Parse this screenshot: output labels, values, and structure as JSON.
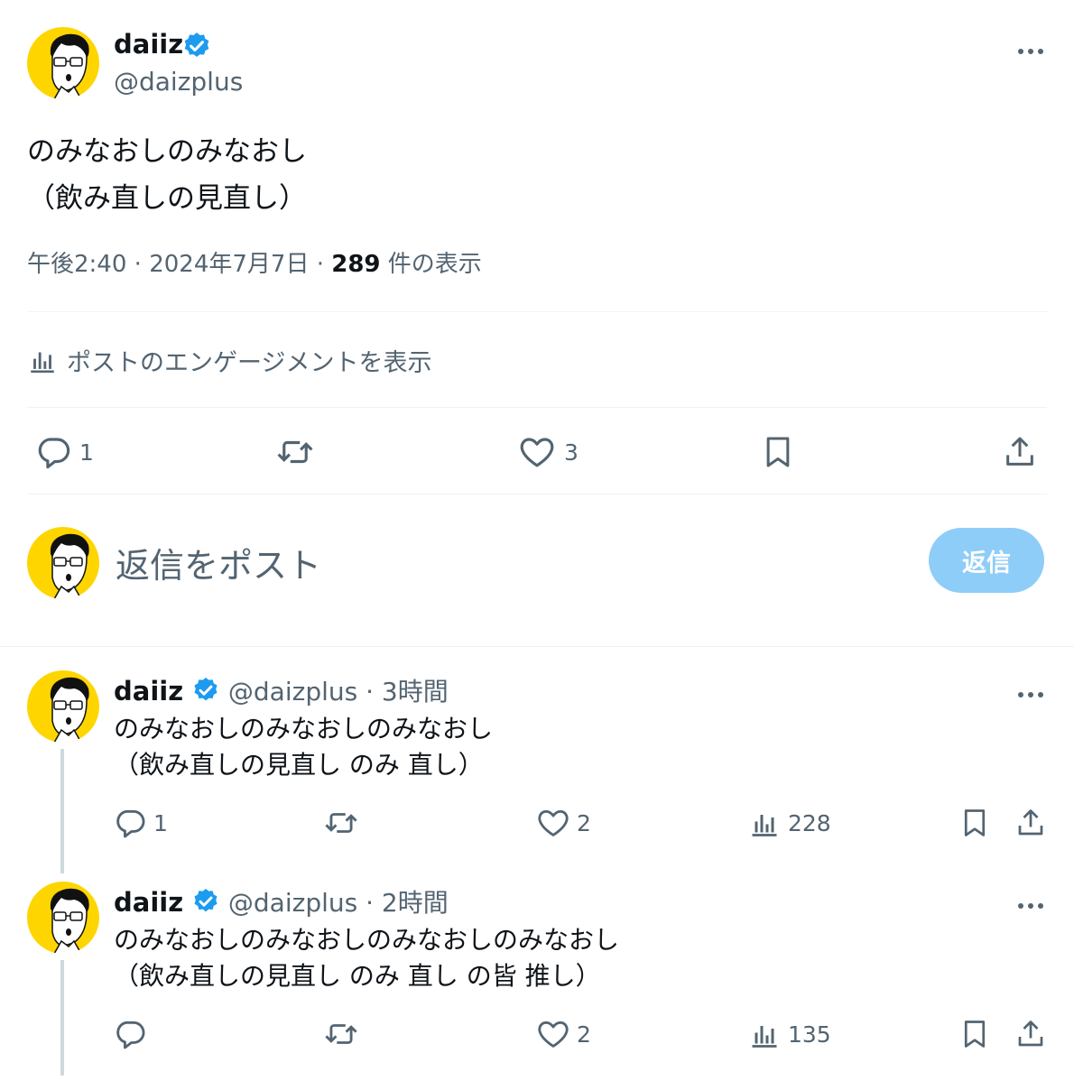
{
  "main_post": {
    "author_name": "daiiz",
    "author_handle": "@daizplus",
    "text_line1": "のみなおしのみなおし",
    "text_line2": "（飲み直しの見直し）",
    "time": "午後2:40",
    "date": "2024年7月7日",
    "views_count": "289",
    "views_label": "件の表示",
    "engagement_link": "ポストのエンゲージメントを表示",
    "actions": {
      "reply_count": "1",
      "like_count": "3"
    }
  },
  "composer": {
    "placeholder": "返信をポスト",
    "reply_button": "返信"
  },
  "replies": [
    {
      "author_name": "daiiz",
      "author_handle": "@daizplus",
      "time": "3時間",
      "text_line1": "のみなおしのみなおしのみなおし",
      "text_line2": "（飲み直しの見直し のみ 直し）",
      "reply_count": "1",
      "like_count": "2",
      "views_count": "228"
    },
    {
      "author_name": "daiiz",
      "author_handle": "@daizplus",
      "time": "2時間",
      "text_line1": "のみなおしのみなおしのみなおしのみなおし",
      "text_line2": "（飲み直しの見直し のみ 直し の皆 推し）",
      "reply_count": "",
      "like_count": "2",
      "views_count": "135"
    }
  ],
  "separator": "·",
  "colors": {
    "accent": "#1d9bf0",
    "reply_button_disabled": "#8ecdf8",
    "avatar_bg": "#ffd500"
  }
}
